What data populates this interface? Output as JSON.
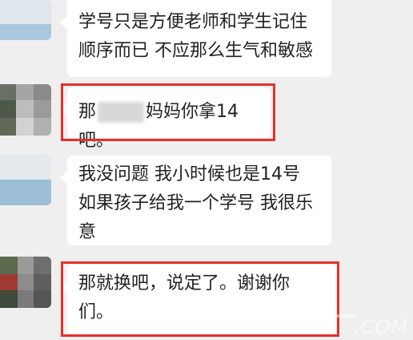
{
  "messages": [
    {
      "lines": [
        "学号只是方便老师和学生记住",
        "顺序而已 不应那么生气和敏感"
      ]
    },
    {
      "before": "那",
      "after": "妈妈你拿14吧。"
    },
    {
      "lines": [
        "我没问题 我小时候也是14号",
        "如果孩子给我一个学号 我很乐",
        "意"
      ]
    },
    {
      "lines": [
        "那就换吧，说定了。谢谢你",
        "们。"
      ]
    }
  ],
  "watermark": ".COM",
  "colors": {
    "highlight": "#e5312b",
    "bubble": "#ffffff",
    "background": "#efefef"
  }
}
